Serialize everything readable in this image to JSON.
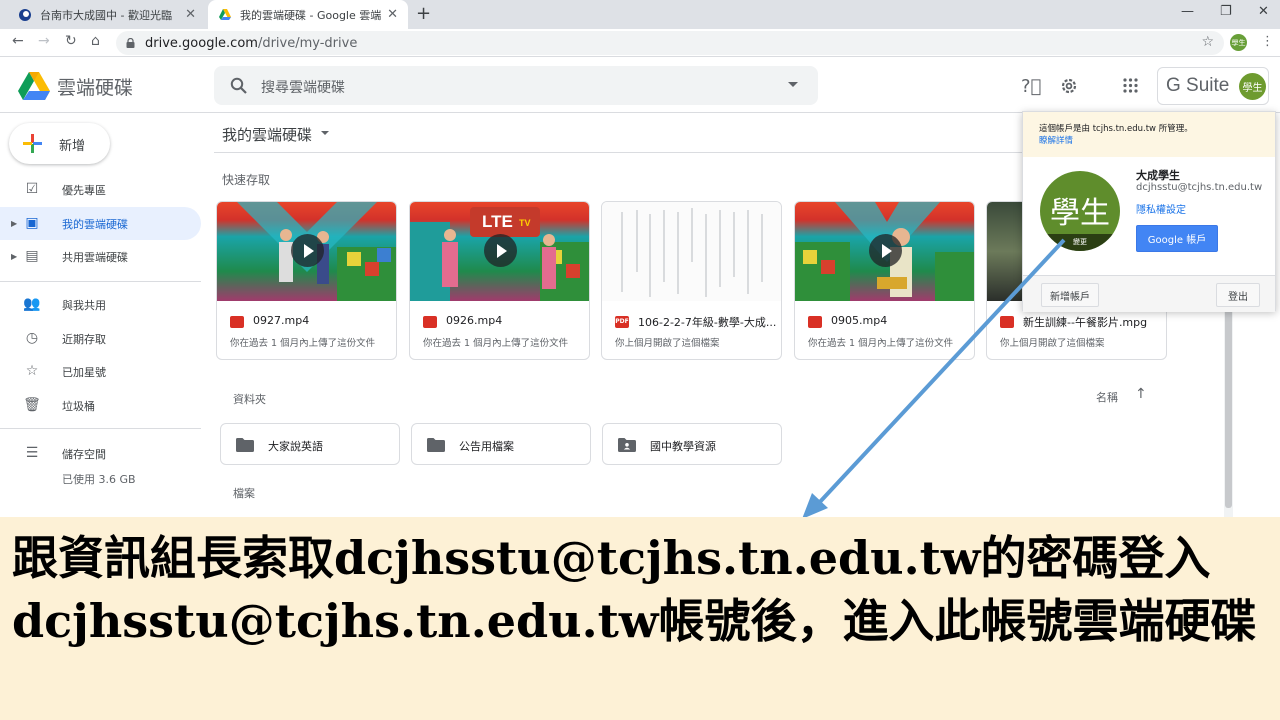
{
  "browser": {
    "tabs": [
      {
        "label": "台南市大成國中 - 歡迎光臨",
        "active": false
      },
      {
        "label": "我的雲端硬碟 - Google 雲端硬碟",
        "active": true
      }
    ],
    "url_host": "drive.google.com",
    "url_path": "/drive/my-drive",
    "avatar_text": "學生"
  },
  "drive": {
    "app_title": "雲端硬碟",
    "search_placeholder": "搜尋雲端硬碟",
    "gsuite_label": "G Suite",
    "header_avatar_text": "學生"
  },
  "sidebar": {
    "new_button": "新增",
    "items": [
      {
        "label": "優先專區",
        "icon": "priority-icon",
        "selected": false
      },
      {
        "label": "我的雲端硬碟",
        "icon": "my-drive-icon",
        "selected": true
      },
      {
        "label": "共用雲端硬碟",
        "icon": "shared-drives-icon",
        "selected": false
      },
      {
        "label": "與我共用",
        "icon": "shared-with-me-icon",
        "selected": false
      },
      {
        "label": "近期存取",
        "icon": "recent-icon",
        "selected": false
      },
      {
        "label": "已加星號",
        "icon": "star-icon",
        "selected": false
      },
      {
        "label": "垃圾桶",
        "icon": "trash-icon",
        "selected": false
      },
      {
        "label": "儲存空間",
        "icon": "storage-icon",
        "selected": false
      }
    ],
    "storage_used": "已使用 3.6 GB"
  },
  "main": {
    "breadcrumb": "我的雲端硬碟",
    "quick_access_label": "快速存取",
    "quick_access": [
      {
        "name": "0927.mp4",
        "subtitle": "你在過去 1 個月內上傳了這份文件",
        "type": "video"
      },
      {
        "name": "0926.mp4",
        "subtitle": "你在過去 1 個月內上傳了這份文件",
        "type": "video"
      },
      {
        "name": "106-2-2-7年級-數學-大成...",
        "subtitle": "你上個月開啟了這個檔案",
        "type": "pdf"
      },
      {
        "name": "0905.mp4",
        "subtitle": "你在過去 1 個月內上傳了這份文件",
        "type": "video"
      },
      {
        "name": "新生訓練--午餐影片.mpg",
        "subtitle": "你上個月開啟了這個檔案",
        "type": "video"
      }
    ],
    "folders_label": "資料夾",
    "sort_label": "名稱",
    "folders": [
      {
        "name": "大家說英語",
        "icon": "folder-icon"
      },
      {
        "name": "公告用檔案",
        "icon": "folder-icon"
      },
      {
        "name": "國中教學資源",
        "icon": "shared-folder-icon"
      }
    ],
    "files_label": "檔案",
    "thumb_tags": {
      "lte": "LTE",
      "tv": "TV"
    }
  },
  "account_popup": {
    "managed_notice": "這個帳戶是由 tcjhs.tn.edu.tw 所管理。",
    "learn_more": "瞭解詳情",
    "avatar_text": "學生",
    "change_label": "變更",
    "name": "大成學生",
    "email": "dcjhsstu@tcjhs.tn.edu.tw",
    "privacy_link": "隱私權設定",
    "google_account_button": "Google 帳戶",
    "add_account_button": "新增帳戶",
    "sign_out_button": "登出"
  },
  "caption": {
    "text": "跟資訊組長索取dcjhsstu@tcjhs.tn.edu.tw的密碼登入dcjhsstu@tcjhs.tn.edu.tw帳號後，進入此帳號雲端硬碟"
  },
  "colors": {
    "accent_blue": "#1a73e8",
    "selected_bg": "#e8f0fe",
    "caption_bg": "#fdf1d6",
    "arrow": "#5b9bd5",
    "avatar_green": "#5f8d2c"
  }
}
